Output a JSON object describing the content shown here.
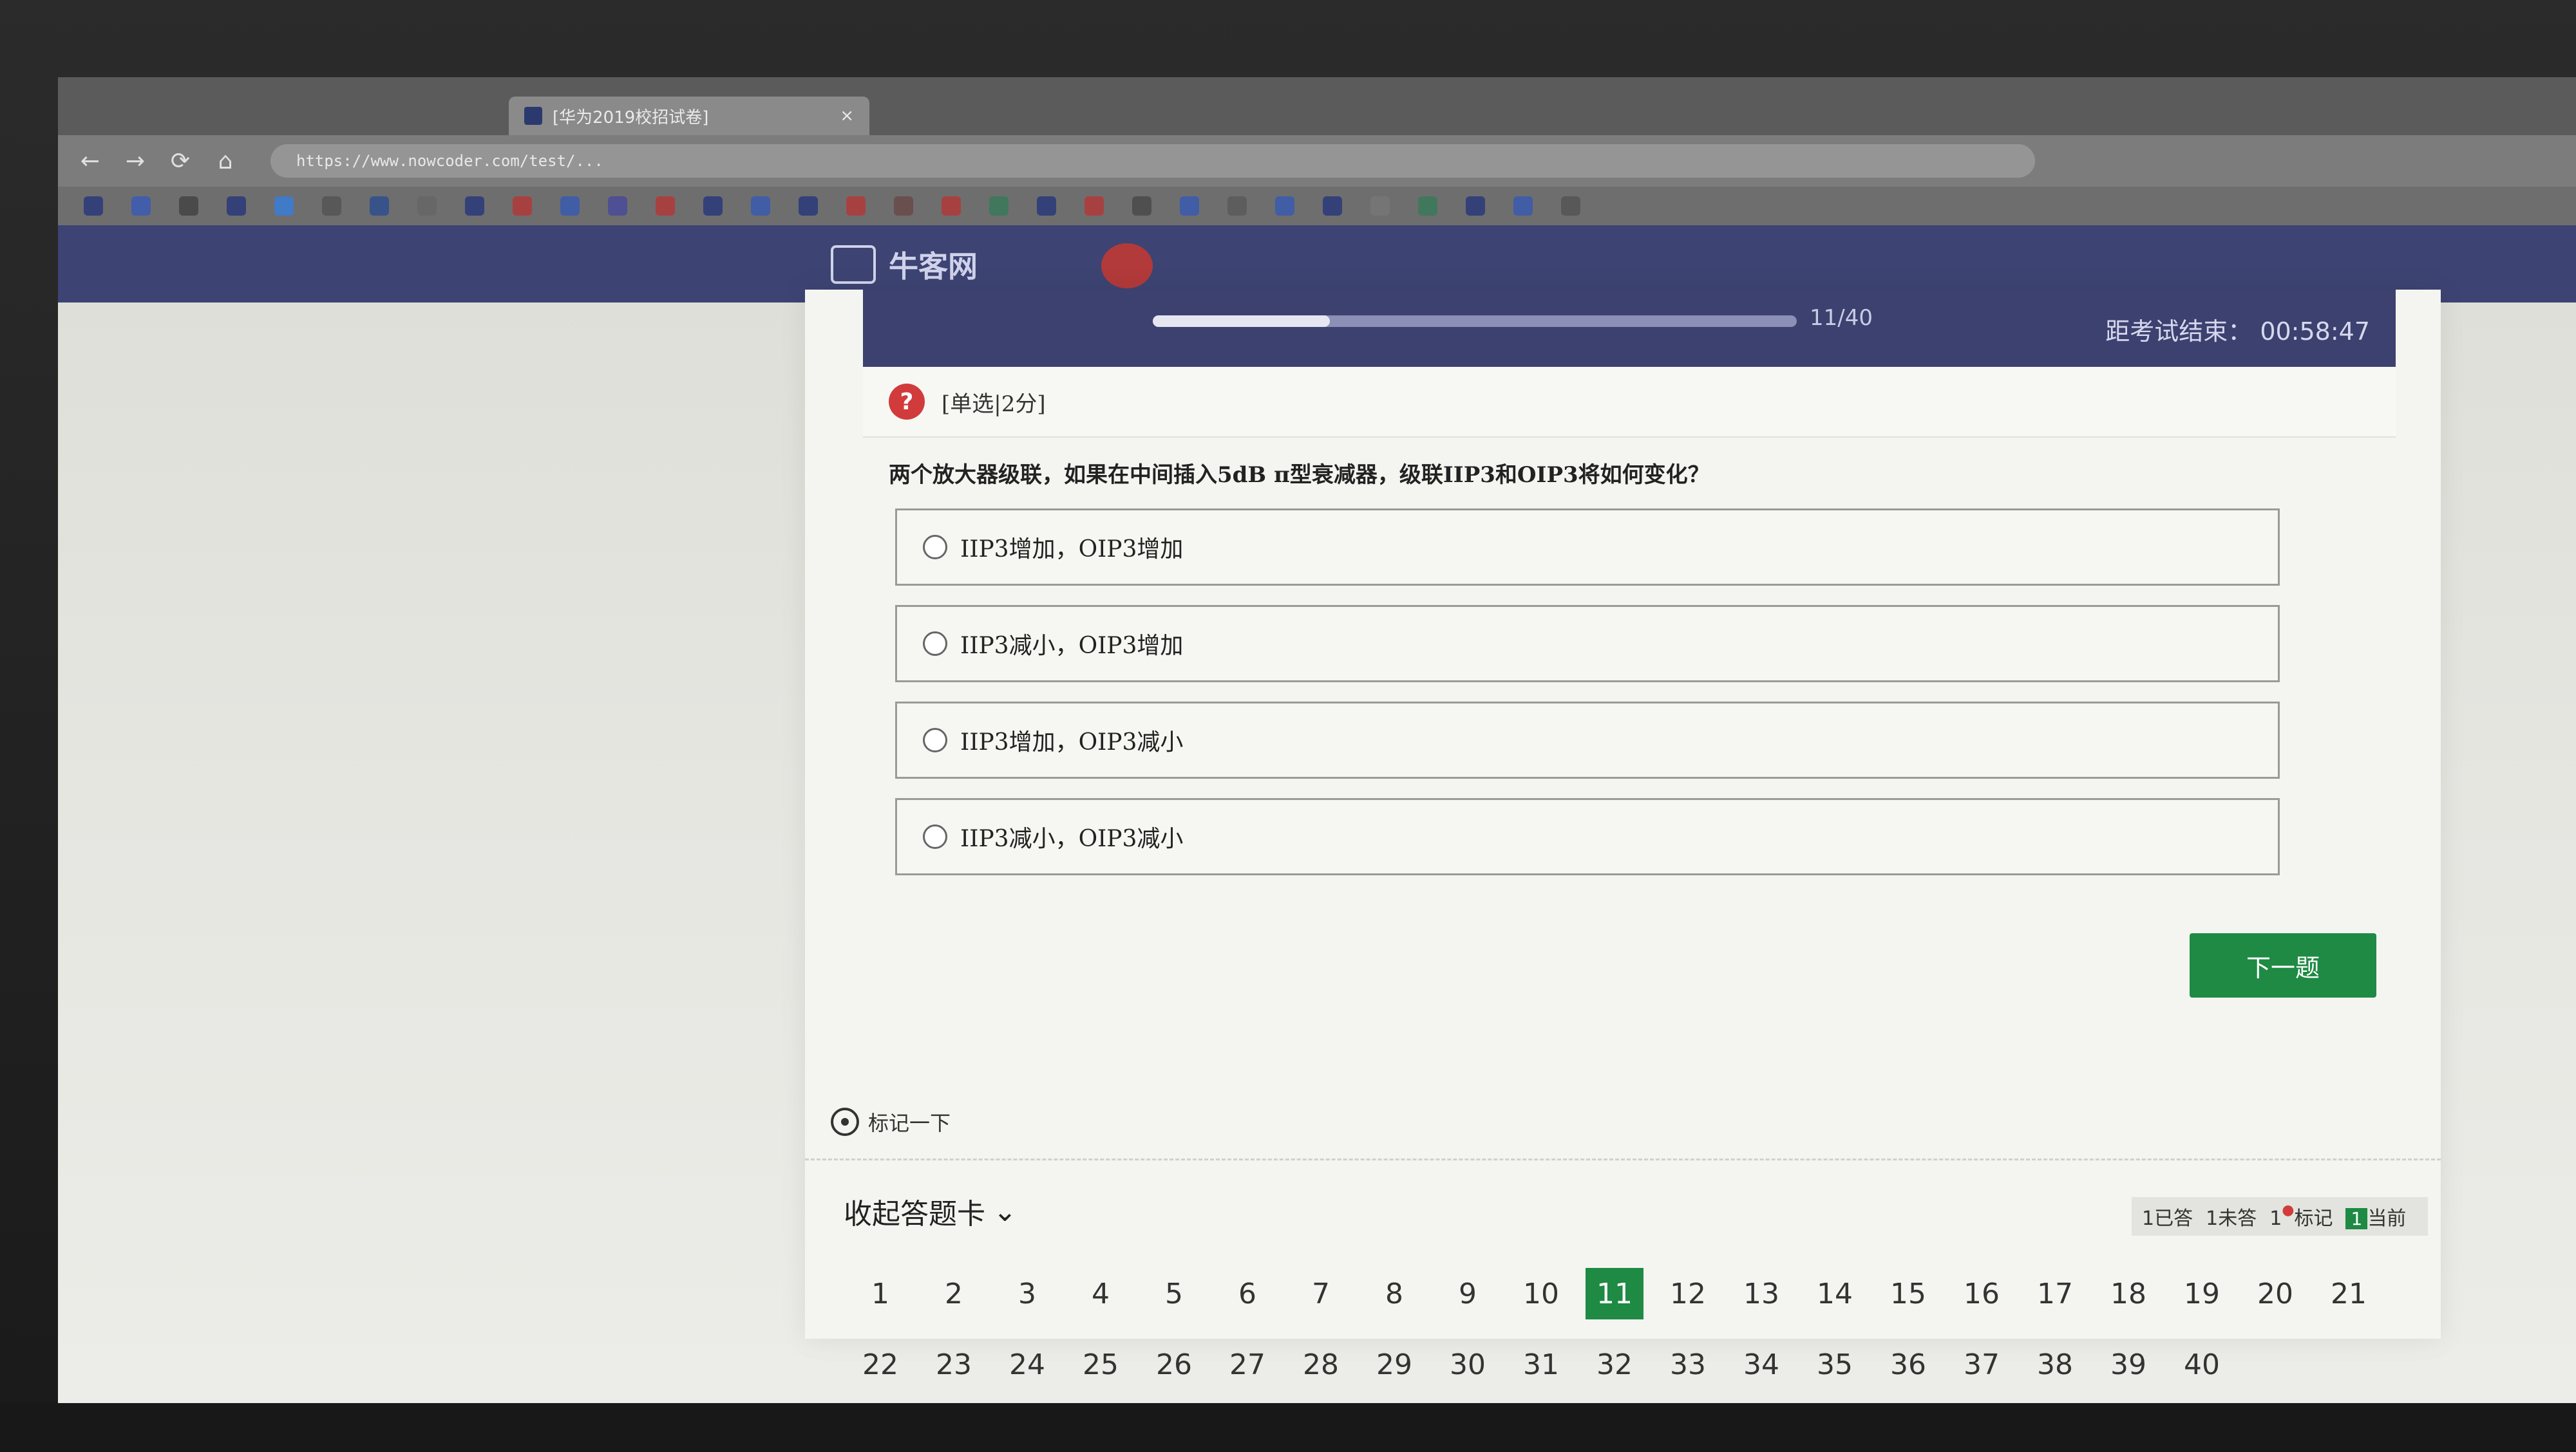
{
  "browser": {
    "tab_title": "[华为2019校招试卷]",
    "tab_close": "×",
    "nav": {
      "back": "←",
      "forward": "→",
      "reload": "⟳",
      "home": "⌂"
    },
    "url": "https://www.nowcoder.com/test/...",
    "bookmark_colors": [
      "#2a3a7a",
      "#3b5bb5",
      "#444444",
      "#2a3a7a",
      "#3a7dd6",
      "#555555",
      "#2f4f8f",
      "#666666",
      "#2a3a7a",
      "#b23a3a",
      "#3a5ab0",
      "#4a4a9a",
      "#b23a3a",
      "#2a3a7a",
      "#3a5ab0",
      "#2a3a7a",
      "#b23a3a",
      "#6a4a4a",
      "#b23a3a",
      "#3a7a5a",
      "#2a3a7a",
      "#b23a3a",
      "#4a4a4a",
      "#3a5ab0",
      "#5a5a5a",
      "#3a5ab0",
      "#2a3a7a",
      "#777777",
      "#3a7a5a",
      "#2a3a7a",
      "#3a5ab0",
      "#555555"
    ]
  },
  "site": {
    "logo_text": "牛客网"
  },
  "exam": {
    "progress_fraction": 0.275,
    "progress_text": "11/40",
    "timer_label": "距考试结束：",
    "timer_value": "00:58:47",
    "question_icon": "?",
    "question_type": "[单选|2分]",
    "question_text": "两个放大器级联，如果在中间插入5dB π型衰减器，级联IIP3和OIP3将如何变化？",
    "options": [
      "IIP3增加，OIP3增加",
      "IIP3减小，OIP3增加",
      "IIP3增加，OIP3减小",
      "IIP3减小，OIP3减小"
    ],
    "next_button": "下一题",
    "mark_label": "标记一下",
    "collapse_label": "收起答题卡",
    "collapse_chevron": "⌄",
    "legend": {
      "answered": "已答",
      "unanswered": "未答",
      "marked": "标记",
      "current": "当前",
      "sample_num": "1"
    },
    "current_question": 11,
    "question_numbers": [
      "1",
      "2",
      "3",
      "4",
      "5",
      "6",
      "7",
      "8",
      "9",
      "10",
      "11",
      "12",
      "13",
      "14",
      "15",
      "16",
      "17",
      "18",
      "19",
      "20",
      "21",
      "22",
      "23",
      "24",
      "25",
      "26",
      "27",
      "28",
      "29",
      "30",
      "31",
      "32",
      "33",
      "34",
      "35",
      "36",
      "37",
      "38",
      "39",
      "40"
    ]
  }
}
